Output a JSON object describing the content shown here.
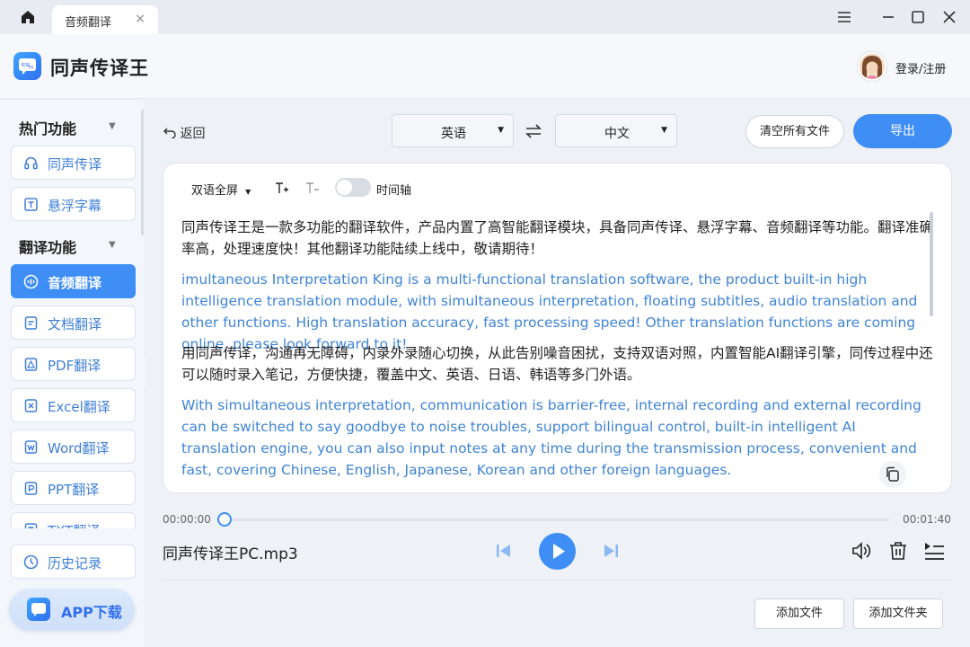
{
  "titlebar": {
    "tab_label": "音频翻译",
    "tab_close": "×"
  },
  "header": {
    "app_title": "同声传译王",
    "login_label": "登录/注册"
  },
  "sidebar": {
    "group1_title": "热门功能",
    "group2_title": "翻译功能",
    "items": [
      {
        "label": "同声传译",
        "icon": "headset-icon"
      },
      {
        "label": "悬浮字幕",
        "icon": "text-box-icon"
      },
      {
        "label": "音频翻译",
        "icon": "audio-icon",
        "active": true
      },
      {
        "label": "文档翻译",
        "icon": "document-icon"
      },
      {
        "label": "PDF翻译",
        "icon": "pdf-icon"
      },
      {
        "label": "Excel翻译",
        "icon": "excel-icon"
      },
      {
        "label": "Word翻译",
        "icon": "word-icon"
      },
      {
        "label": "PPT翻译",
        "icon": "ppt-icon"
      },
      {
        "label": "TXT翻译",
        "icon": "txt-icon"
      }
    ],
    "history_label": "历史记录",
    "app_download_label": "APP下载"
  },
  "toolbar": {
    "back_label": "返回",
    "source_lang": "英语",
    "target_lang": "中文",
    "clear_label": "清空所有文件",
    "export_label": "导出"
  },
  "panel": {
    "view_mode": "双语全屏",
    "timeline_label": "时间轴",
    "timeline_on": false,
    "paragraphs": [
      {
        "lang": "zh",
        "text": "同声传译王是一款多功能的翻译软件，产品内置了高智能翻译模块，具备同声传译、悬浮字幕、音频翻译等功能。翻译准确率高，处理速度快！其他翻译功能陆续上线中，敬请期待！"
      },
      {
        "lang": "en",
        "text": "imultaneous Interpretation King is a multi-functional translation software, the product built-in high intelligence translation module, with simultaneous interpretation, floating subtitles, audio translation and other functions. High translation accuracy, fast processing speed! Other translation functions are coming online, please look forward to it!"
      },
      {
        "lang": "zh",
        "text": "用同声传译，沟通再无障碍，内录外录随心切换，从此告别噪音困扰，支持双语对照，内置智能AI翻译引擎，同传过程中还可以随时录入笔记，方便快捷，覆盖中文、英语、日语、韩语等多门外语。"
      },
      {
        "lang": "en",
        "text": "With simultaneous interpretation, communication is barrier-free, internal recording and external recording can be switched to say goodbye to noise troubles, support bilingual control, built-in intelligent AI translation engine, you can also input notes at any time during the transmission process, convenient and fast, covering Chinese, English, Japanese, Korean and other foreign languages."
      }
    ]
  },
  "player": {
    "current_time": "00:00:00",
    "total_time": "00:01:40",
    "progress": 0,
    "filename": "同声传译王PC.mp3"
  },
  "footer": {
    "add_file_label": "添加文件",
    "add_folder_label": "添加文件夹"
  },
  "colors": {
    "accent": "#3f8ef5",
    "english_text": "#3f84d6"
  }
}
